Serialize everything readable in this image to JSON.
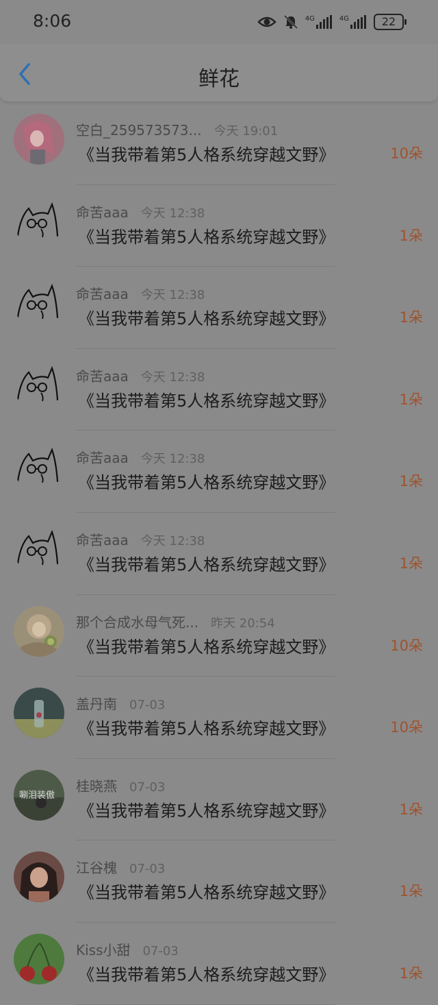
{
  "status_bar": {
    "time": "8:06",
    "icons": [
      "eye-icon",
      "bell-muted-icon",
      "4g-signal-icon",
      "4g-signal-icon"
    ],
    "signal_label_1": "4G",
    "signal_label_2": "4G",
    "battery": "22"
  },
  "header": {
    "title": "鲜花",
    "back_icon": "chevron-left-icon",
    "accent_color": "#2f6fb3"
  },
  "rows": [
    {
      "name": "空白_259573573...",
      "time": "今天 19:01",
      "book": "《当我带着第5人格系统穿越文野》",
      "count": "10朵",
      "avatar": "avatar-photo-pink"
    },
    {
      "name": "命苦aaa",
      "time": "今天 12:38",
      "book": "《当我带着第5人格系统穿越文野》",
      "count": "1朵",
      "avatar": "avatar-cat-sketch"
    },
    {
      "name": "命苦aaa",
      "time": "今天 12:38",
      "book": "《当我带着第5人格系统穿越文野》",
      "count": "1朵",
      "avatar": "avatar-cat-sketch"
    },
    {
      "name": "命苦aaa",
      "time": "今天 12:38",
      "book": "《当我带着第5人格系统穿越文野》",
      "count": "1朵",
      "avatar": "avatar-cat-sketch"
    },
    {
      "name": "命苦aaa",
      "time": "今天 12:38",
      "book": "《当我带着第5人格系统穿越文野》",
      "count": "1朵",
      "avatar": "avatar-cat-sketch"
    },
    {
      "name": "命苦aaa",
      "time": "今天 12:38",
      "book": "《当我带着第5人格系统穿越文野》",
      "count": "1朵",
      "avatar": "avatar-cat-sketch"
    },
    {
      "name": "那个合成水母气死...",
      "time": "昨天 20:54",
      "book": "《当我带着第5人格系统穿越文野》",
      "count": "10朵",
      "avatar": "avatar-illustration"
    },
    {
      "name": "盖丹南",
      "time": "07-03",
      "book": "《当我带着第5人格系统穿越文野》",
      "count": "10朵",
      "avatar": "avatar-photo-bottle"
    },
    {
      "name": "桂晓燕",
      "time": "07-03",
      "book": "《当我带着第5人格系统穿越文野》",
      "count": "1朵",
      "avatar": "avatar-photo-text"
    },
    {
      "name": "江谷槐",
      "time": "07-03",
      "book": "《当我带着第5人格系统穿越文野》",
      "count": "1朵",
      "avatar": "avatar-photo-girl"
    },
    {
      "name": "Kiss小甜",
      "time": "07-03",
      "book": "《当我带着第5人格系统穿越文野》",
      "count": "1朵",
      "avatar": "avatar-photo-cherry"
    }
  ],
  "avatar_text": {
    "photo_text": "唰泪装傲"
  }
}
